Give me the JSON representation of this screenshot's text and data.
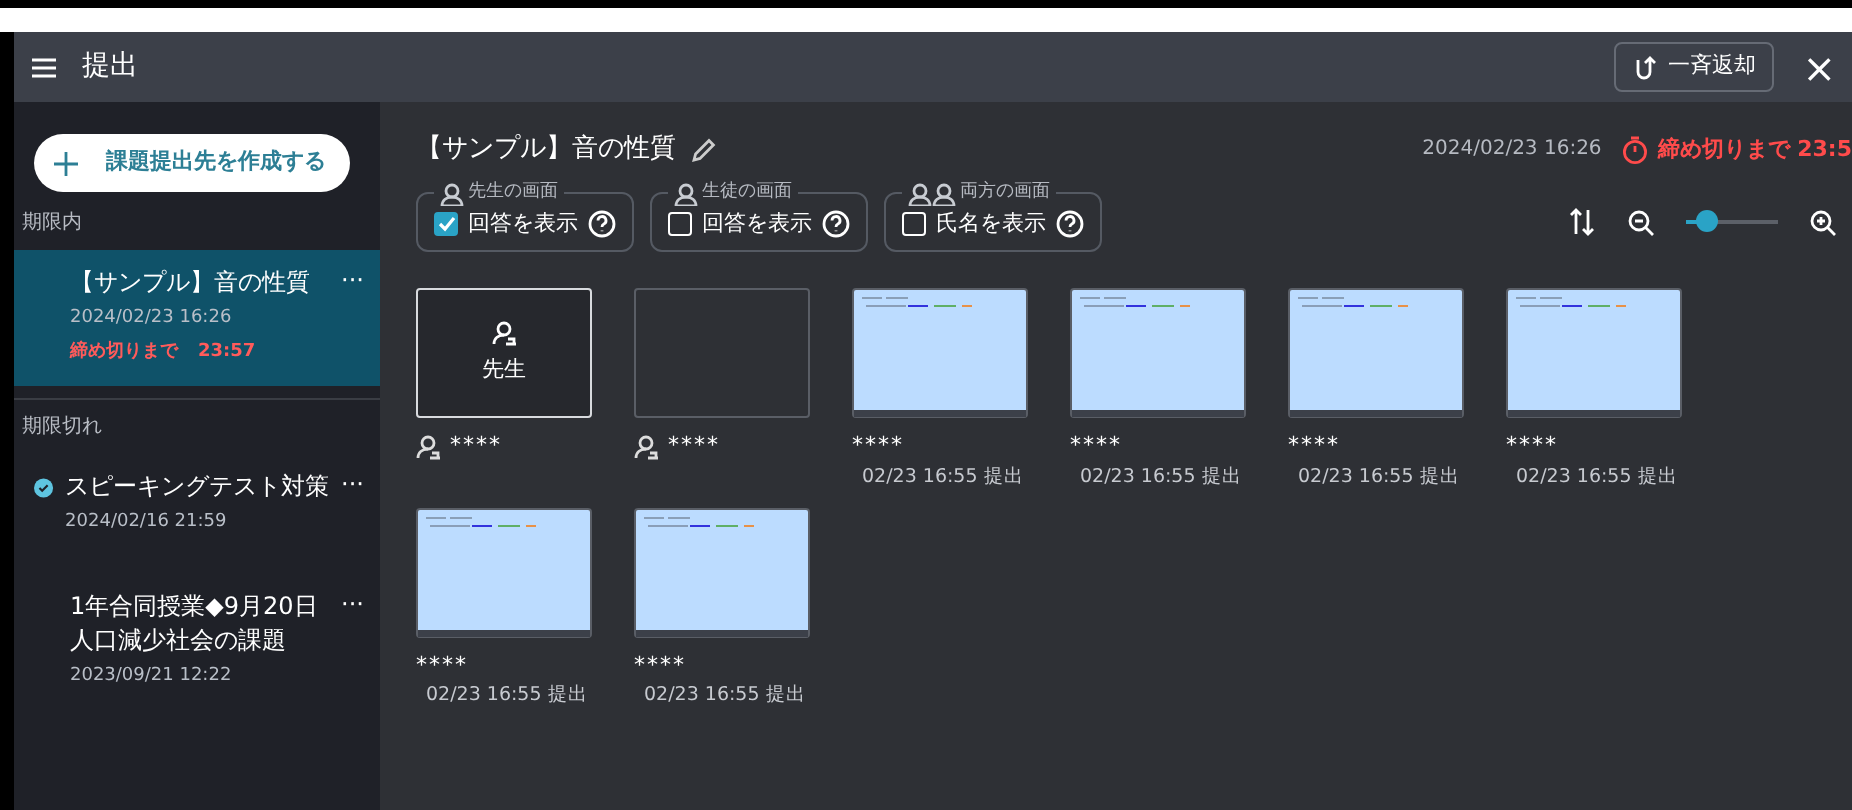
{
  "header": {
    "title": "提出",
    "return_button": "一斉返却",
    "close": "×"
  },
  "sidebar": {
    "create_button": "課題提出先を作成する",
    "sections": [
      {
        "label": "期限内",
        "items": [
          {
            "title_lines": [
              "【サンプル】音の性質"
            ],
            "date": "2024/02/23 16:26",
            "deadline_label": "締め切りまで",
            "deadline_time": "23:57",
            "done": false,
            "selected": true,
            "more": "···"
          }
        ]
      },
      {
        "label": "期限切れ",
        "items": [
          {
            "title_lines": [
              "スピーキングテスト対策"
            ],
            "date": "2024/02/16 21:59",
            "done": true,
            "selected": false,
            "more": "···"
          },
          {
            "title_lines": [
              "1年合同授業◆9月20日",
              "人口減少社会の課題"
            ],
            "date": "2023/09/21 12:22",
            "done": false,
            "selected": false,
            "more": "···"
          }
        ]
      }
    ]
  },
  "assignment": {
    "title": "【サンプル】音の性質",
    "date": "2024/02/23 16:26",
    "deadline": "締め切りまで 23:5",
    "options": [
      {
        "kind": "teacher",
        "legend": "先生の画面",
        "label": "回答を表示",
        "checked": true
      },
      {
        "kind": "student",
        "legend": "生徒の画面",
        "label": "回答を表示",
        "checked": false
      },
      {
        "kind": "both",
        "legend": "両方の画面",
        "label": "氏名を表示",
        "checked": false
      }
    ],
    "zoom": {
      "level": 0.22
    }
  },
  "submissions": [
    {
      "kind": "teacher",
      "label": "先生",
      "name": "****",
      "selected": true
    },
    {
      "kind": "empty",
      "name": "****",
      "selected": false
    },
    {
      "kind": "thumbnail",
      "name": "****",
      "time": "02/23 16:55 提出",
      "selected": false
    },
    {
      "kind": "thumbnail",
      "name": "****",
      "time": "02/23 16:55 提出",
      "selected": false
    },
    {
      "kind": "thumbnail",
      "name": "****",
      "time": "02/23 16:55 提出",
      "selected": false
    },
    {
      "kind": "thumbnail",
      "name": "****",
      "time": "02/23 16:55 提出",
      "selected": false
    },
    {
      "kind": "thumbnail",
      "name": "****",
      "time": "02/23 16:55 提出",
      "selected": false
    },
    {
      "kind": "thumbnail",
      "name": "****",
      "time": "02/23 16:55 提出",
      "selected": false
    }
  ]
}
